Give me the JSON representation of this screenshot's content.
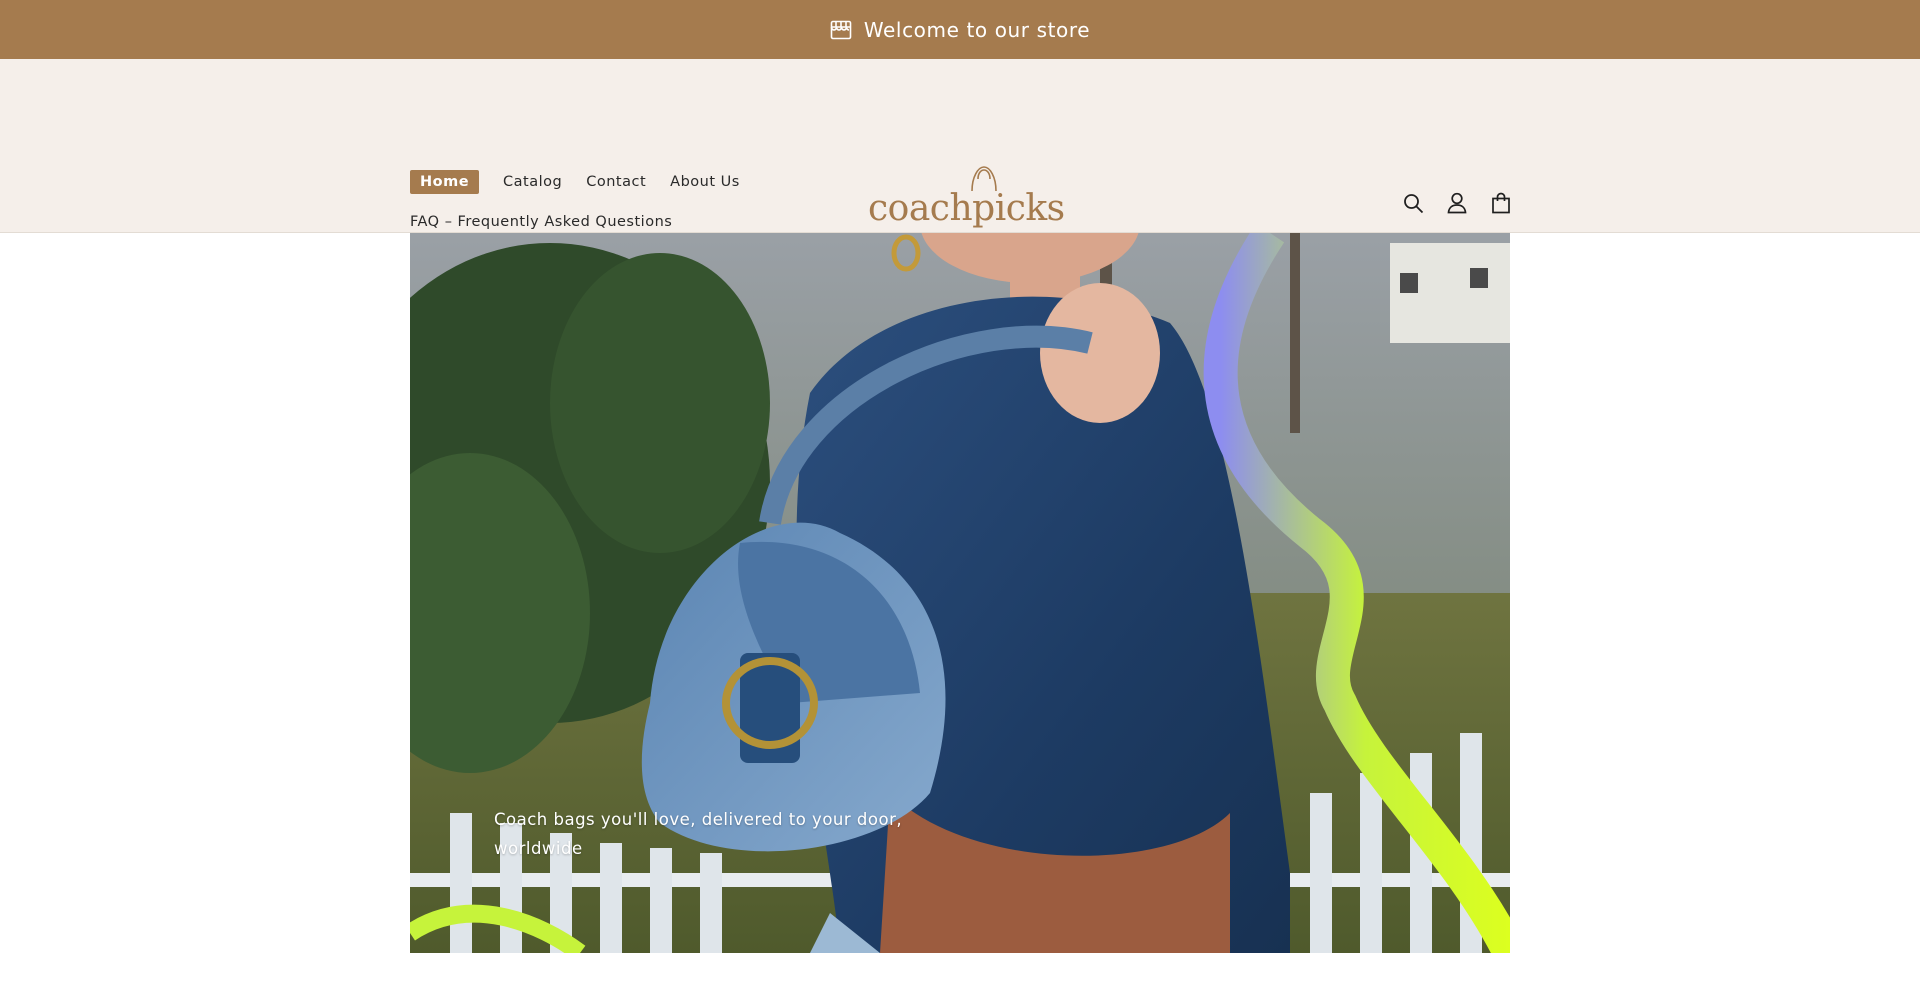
{
  "announcement": {
    "icon": "store-icon",
    "text": "Welcome to our store"
  },
  "nav": {
    "items": [
      {
        "label": "Home",
        "active": true
      },
      {
        "label": "Catalog"
      },
      {
        "label": "Contact"
      },
      {
        "label": "About Us"
      },
      {
        "label": "FAQ – Frequently Asked Questions"
      }
    ]
  },
  "logo": {
    "text": "coachpicks",
    "icon": "handbag-icon"
  },
  "header_icons": [
    "search-icon",
    "account-icon",
    "cart-icon"
  ],
  "hero": {
    "caption": "Coach bags you'll love, delivered to your door, worldwide"
  },
  "colors": {
    "brand": "#a57b4e",
    "header_bg": "#f5efea"
  }
}
